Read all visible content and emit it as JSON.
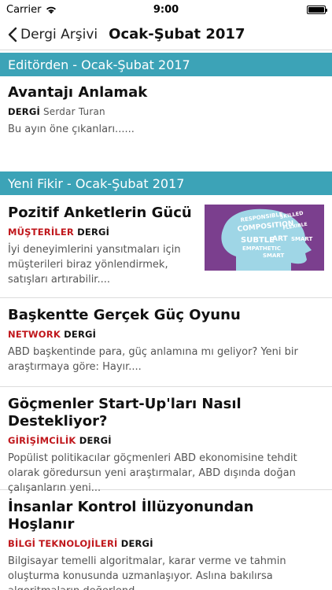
{
  "status": {
    "carrier": "Carrier",
    "time": "9:00"
  },
  "nav": {
    "back_label": "Dergi Arşivi",
    "title": "Ocak-Şubat 2017"
  },
  "sections": [
    {
      "title": "Editörden - Ocak-Şubat 2017"
    },
    {
      "title": "Yeni Fikir - Ocak-Şubat 2017"
    }
  ],
  "articles": [
    {
      "title": "Avantajı Anlamak",
      "category": "DERGİ",
      "author": "Serdar Turan",
      "snippet": "Bu ayın öne çıkanları......"
    },
    {
      "title": "Pozitif Anketlerin Gücü",
      "category": "MÜŞTERİLER",
      "tag": "DERGİ",
      "snippet": "İyi deneyimlerini yansıtmaları için müşterileri biraz yönlendirmek, satışları artırabilir....",
      "thumbnail_words": [
        "RESPONSIBLE",
        "SKILLED",
        "COMPOSITION",
        "FLEXIBLE",
        "SUBTLE",
        "ART",
        "SMART",
        "EMPATHETIC",
        "SMART"
      ]
    },
    {
      "title": "Başkentte Gerçek Güç Oyunu",
      "category": "NETWORK",
      "tag": "DERGİ",
      "snippet": "ABD başkentinde para, güç anlamına mı geliyor? Yeni bir araştırmaya göre: Hayır...."
    },
    {
      "title": "Göçmenler Start-Up'ları Nasıl Destekliyor?",
      "category": "GİRİŞİMCİLİK",
      "tag": "DERGİ",
      "snippet": "Popülist politikacılar göçmenleri ABD ekonomisine tehdit olarak göredursun yeni araştırmalar, ABD dışında doğan çalışanların yeni..."
    },
    {
      "title": "İnsanlar Kontrol İllüzyonundan Hoşlanır",
      "category": "BİLGİ TEKNOLOJİLERİ",
      "tag": "DERGİ",
      "snippet": "Bilgisayar temelli algoritmalar, karar verme ve tahmin oluşturma konusunda uzmanlaşıyor. Aslına bakılırsa algoritmaların değerlend..."
    }
  ]
}
